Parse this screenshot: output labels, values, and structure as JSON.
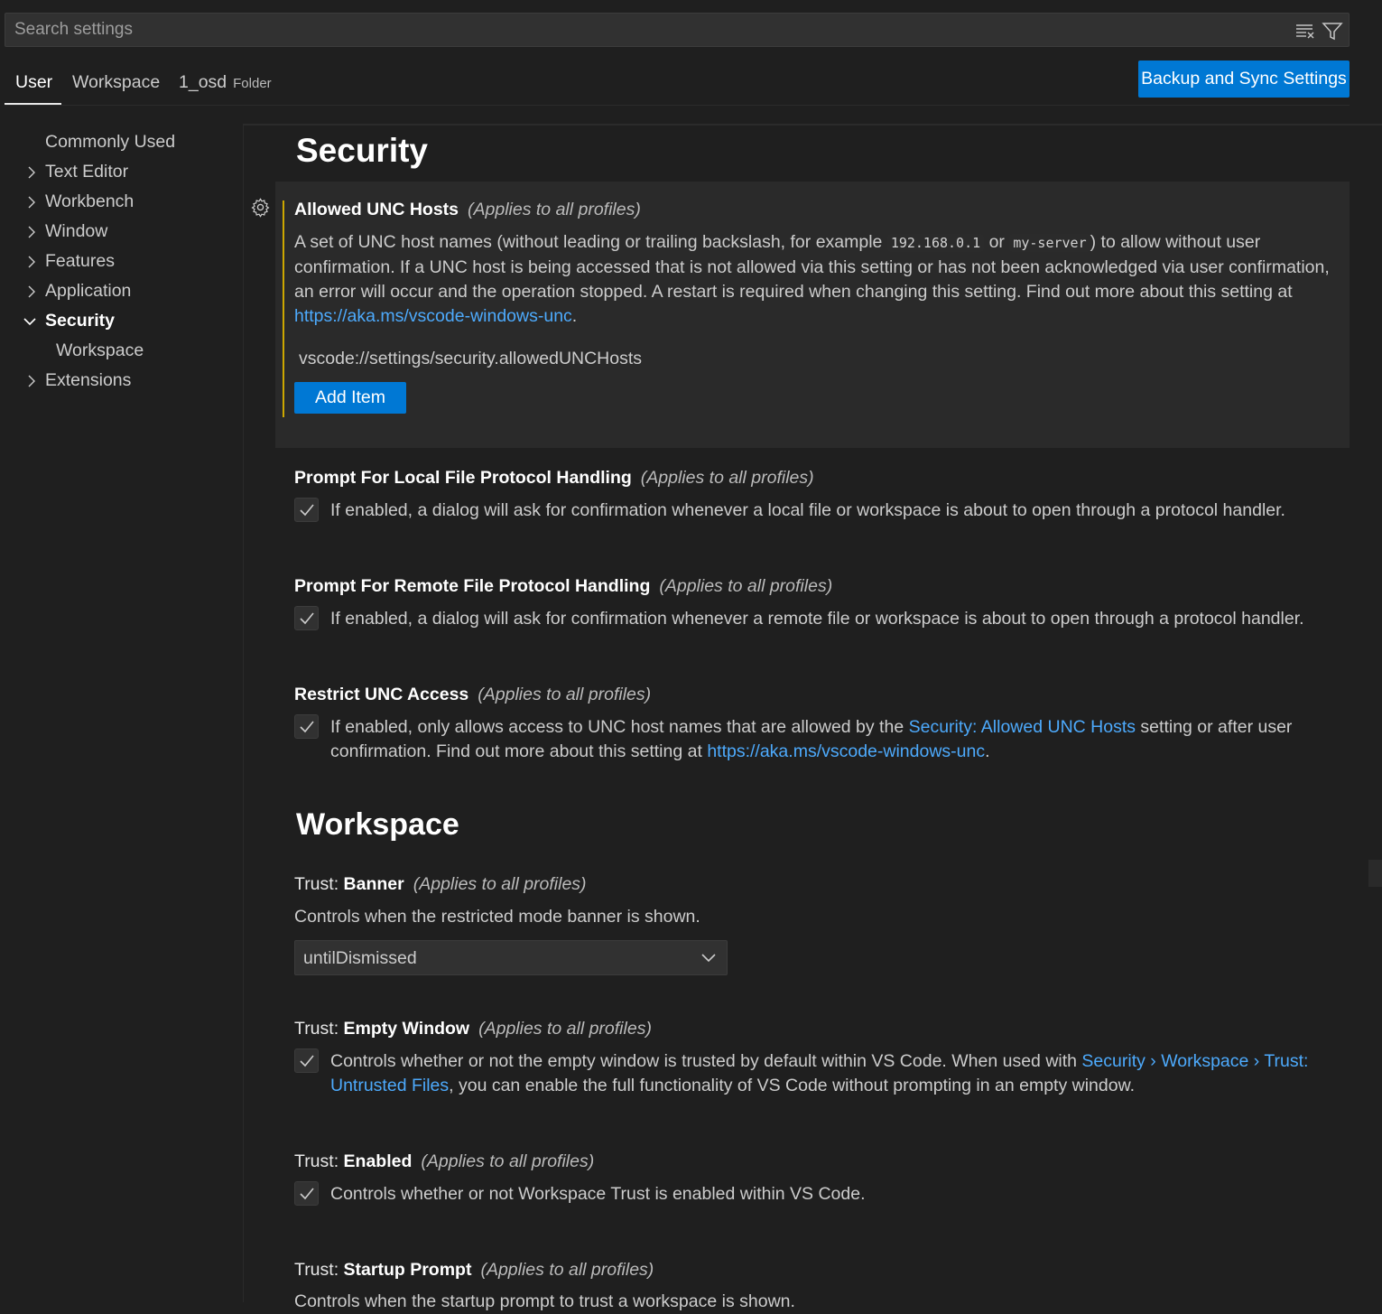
{
  "search": {
    "placeholder": "Search settings"
  },
  "tabs": {
    "user": "User",
    "workspace": "Workspace",
    "folder_name": "1_osd",
    "folder_tag": "Folder"
  },
  "sync_button": "Backup and Sync Settings",
  "toc": {
    "items": [
      {
        "label": "Commonly Used"
      },
      {
        "label": "Text Editor"
      },
      {
        "label": "Workbench"
      },
      {
        "label": "Window"
      },
      {
        "label": "Features"
      },
      {
        "label": "Application"
      },
      {
        "label": "Security"
      },
      {
        "label": "Workspace"
      },
      {
        "label": "Extensions"
      }
    ]
  },
  "security": {
    "title": "Security",
    "unc_hosts": {
      "name": "Allowed UNC Hosts",
      "scope": "(Applies to all profiles)",
      "desc_1": "A set of UNC host names (without leading or trailing backslash, for example ",
      "code_1": "192.168.0.1",
      "desc_2": " or ",
      "code_2": "my-server",
      "desc_3": ") to allow without user",
      "desc_4": "confirmation. If a UNC host is being accessed that is not allowed via this setting or has not been acknowledged via user confirmation,",
      "desc_5": "an error will occur and the operation stopped. A restart is required when changing this setting. Find out more about this setting at",
      "link": "https://aka.ms/vscode-windows-unc",
      "link_suffix": ".",
      "url": "vscode://settings/security.allowedUNCHosts",
      "add_item": "Add Item"
    },
    "local_protocol": {
      "name": "Prompt For Local File Protocol Handling",
      "scope": "(Applies to all profiles)",
      "desc": "If enabled, a dialog will ask for confirmation whenever a local file or workspace is about to open through a protocol handler."
    },
    "remote_protocol": {
      "name": "Prompt For Remote File Protocol Handling",
      "scope": "(Applies to all profiles)",
      "desc": "If enabled, a dialog will ask for confirmation whenever a remote file or workspace is about to open through a protocol handler."
    },
    "restrict_unc": {
      "name": "Restrict UNC Access",
      "scope": "(Applies to all profiles)",
      "desc_1": "If enabled, only allows access to UNC host names that are allowed by the ",
      "link_1": "Security: Allowed UNC Hosts",
      "desc_2": " setting or after user",
      "desc_3": "confirmation. Find out more about this setting at ",
      "link_2": "https://aka.ms/vscode-windows-unc",
      "desc_4": "."
    }
  },
  "workspace": {
    "title": "Workspace",
    "banner": {
      "cat": "Trust: ",
      "name": "Banner",
      "scope": "(Applies to all profiles)",
      "desc": "Controls when the restricted mode banner is shown.",
      "value": "untilDismissed"
    },
    "empty_window": {
      "cat": "Trust: ",
      "name": "Empty Window",
      "scope": "(Applies to all profiles)",
      "desc_1": "Controls whether or not the empty window is trusted by default within VS Code. When used with ",
      "link_1": "Security › Workspace › Trust:",
      "link_2": "Untrusted Files",
      "desc_2": ", you can enable the full functionality of VS Code without prompting in an empty window."
    },
    "enabled": {
      "cat": "Trust: ",
      "name": "Enabled",
      "scope": "(Applies to all profiles)",
      "desc": "Controls whether or not Workspace Trust is enabled within VS Code."
    },
    "startup_prompt": {
      "cat": "Trust: ",
      "name": "Startup Prompt",
      "scope": "(Applies to all profiles)",
      "desc": "Controls when the startup prompt to trust a workspace is shown."
    }
  },
  "colors": {
    "accent": "#0078d4",
    "link": "#4daafc",
    "focus_bar": "#cca700"
  }
}
